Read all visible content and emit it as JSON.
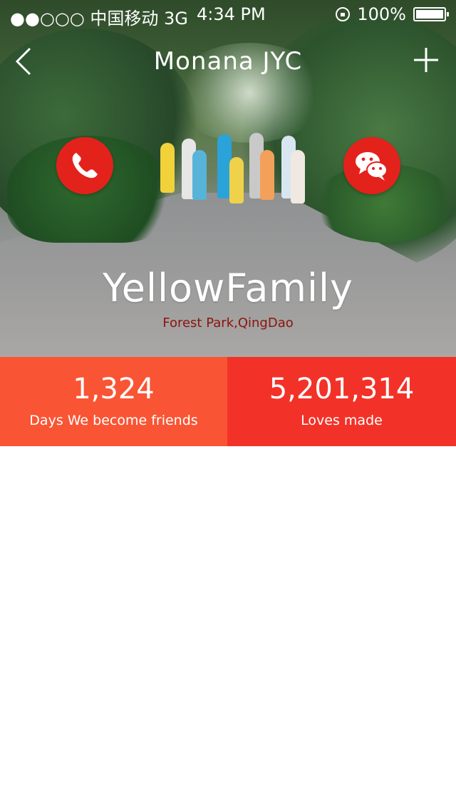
{
  "status_bar": {
    "carrier": "●●○○○ 中国移动 3G",
    "time": "4:34 PM",
    "battery_percent": "100%"
  },
  "nav": {
    "title": "Monana JYC",
    "back_icon": "chevron-left-icon",
    "add_icon": "plus-icon"
  },
  "hero": {
    "group_name": "YellowFamily",
    "location": "Forest Park,QingDao",
    "call_icon": "phone-icon",
    "chat_icon": "wechat-icon"
  },
  "stats": [
    {
      "value": "1,324",
      "label": "Days We become friends"
    },
    {
      "value": "5,201,314",
      "label": "Loves made"
    }
  ],
  "colors": {
    "accent_red": "#e3221b",
    "stat_left_bg": "#f95534",
    "stat_right_bg": "#f23228",
    "location_text": "#8a140f"
  }
}
